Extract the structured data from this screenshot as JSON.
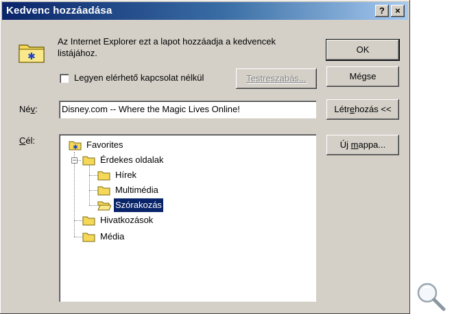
{
  "window": {
    "title": "Kedvenc hozzáadása",
    "help_button": "?",
    "close_button": "×"
  },
  "message": "Az Internet Explorer ezt a lapot hozzáadja a kedvencek listájához.",
  "offline_checkbox": {
    "label_pre": "Le",
    "label_mnemonic": "g",
    "label_post": "yen elérhető kapcsolat nélkül",
    "checked": false
  },
  "buttons": {
    "customize": "Testreszabás...",
    "ok": "OK",
    "cancel": "Mégse",
    "create_in_pre": "Létr",
    "create_in_mnemonic": "e",
    "create_in_post": "hozás <<",
    "new_folder_pre": "Új ",
    "new_folder_mnemonic": "m",
    "new_folder_post": "appa..."
  },
  "name_field": {
    "label_pre": "Né",
    "label_mnemonic": "v",
    "label_post": ":",
    "value": "Disney.com -- Where the Magic Lives Online!"
  },
  "target_label": {
    "mnemonic": "C",
    "rest": "él:"
  },
  "tree": {
    "root": "Favorites",
    "items": [
      {
        "label": "Érdekes oldalak"
      },
      {
        "label": "Hírek"
      },
      {
        "label": "Multimédia"
      },
      {
        "label": "Szórakozás",
        "selected": true
      },
      {
        "label": "Hivatkozások"
      },
      {
        "label": "Média"
      }
    ]
  },
  "colors": {
    "dialog_bg": "#d4d0c8",
    "title_start": "#0a246a",
    "title_end": "#a6caf0",
    "selection": "#0a246a",
    "folder": "#f5d858"
  }
}
